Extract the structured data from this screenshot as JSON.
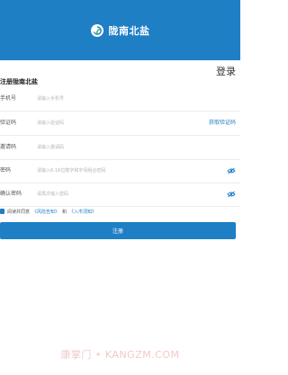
{
  "header": {
    "title": "陇南北盐",
    "logo_icon": "swirl-logo-icon"
  },
  "login_link": "登录",
  "page_subtitle": "注册陇南北盐",
  "form": {
    "phone": {
      "label": "手机号",
      "placeholder": "请输入手机号"
    },
    "code": {
      "label": "验证码",
      "placeholder": "请输入验证码",
      "action": "获取验证码"
    },
    "invite": {
      "label": "邀请码",
      "placeholder": "请输入邀请码"
    },
    "password": {
      "label": "密码",
      "placeholder": "请输入6-16位数字和字母组合密码",
      "toggle_icon": "eye-hidden-icon"
    },
    "confirm": {
      "label": "确认密码",
      "placeholder": "请再次输入密码",
      "toggle_icon": "eye-hidden-icon"
    }
  },
  "agreement": {
    "checked": true,
    "prefix": "阅读并同意",
    "link1": "《风险告知》",
    "middle": "和",
    "link2": "《入市须知》"
  },
  "submit_label": "注册",
  "watermark": "康掌门 • KANGZM.COM",
  "colors": {
    "brand": "#1e7fc4",
    "placeholder": "#b5b5b5"
  }
}
